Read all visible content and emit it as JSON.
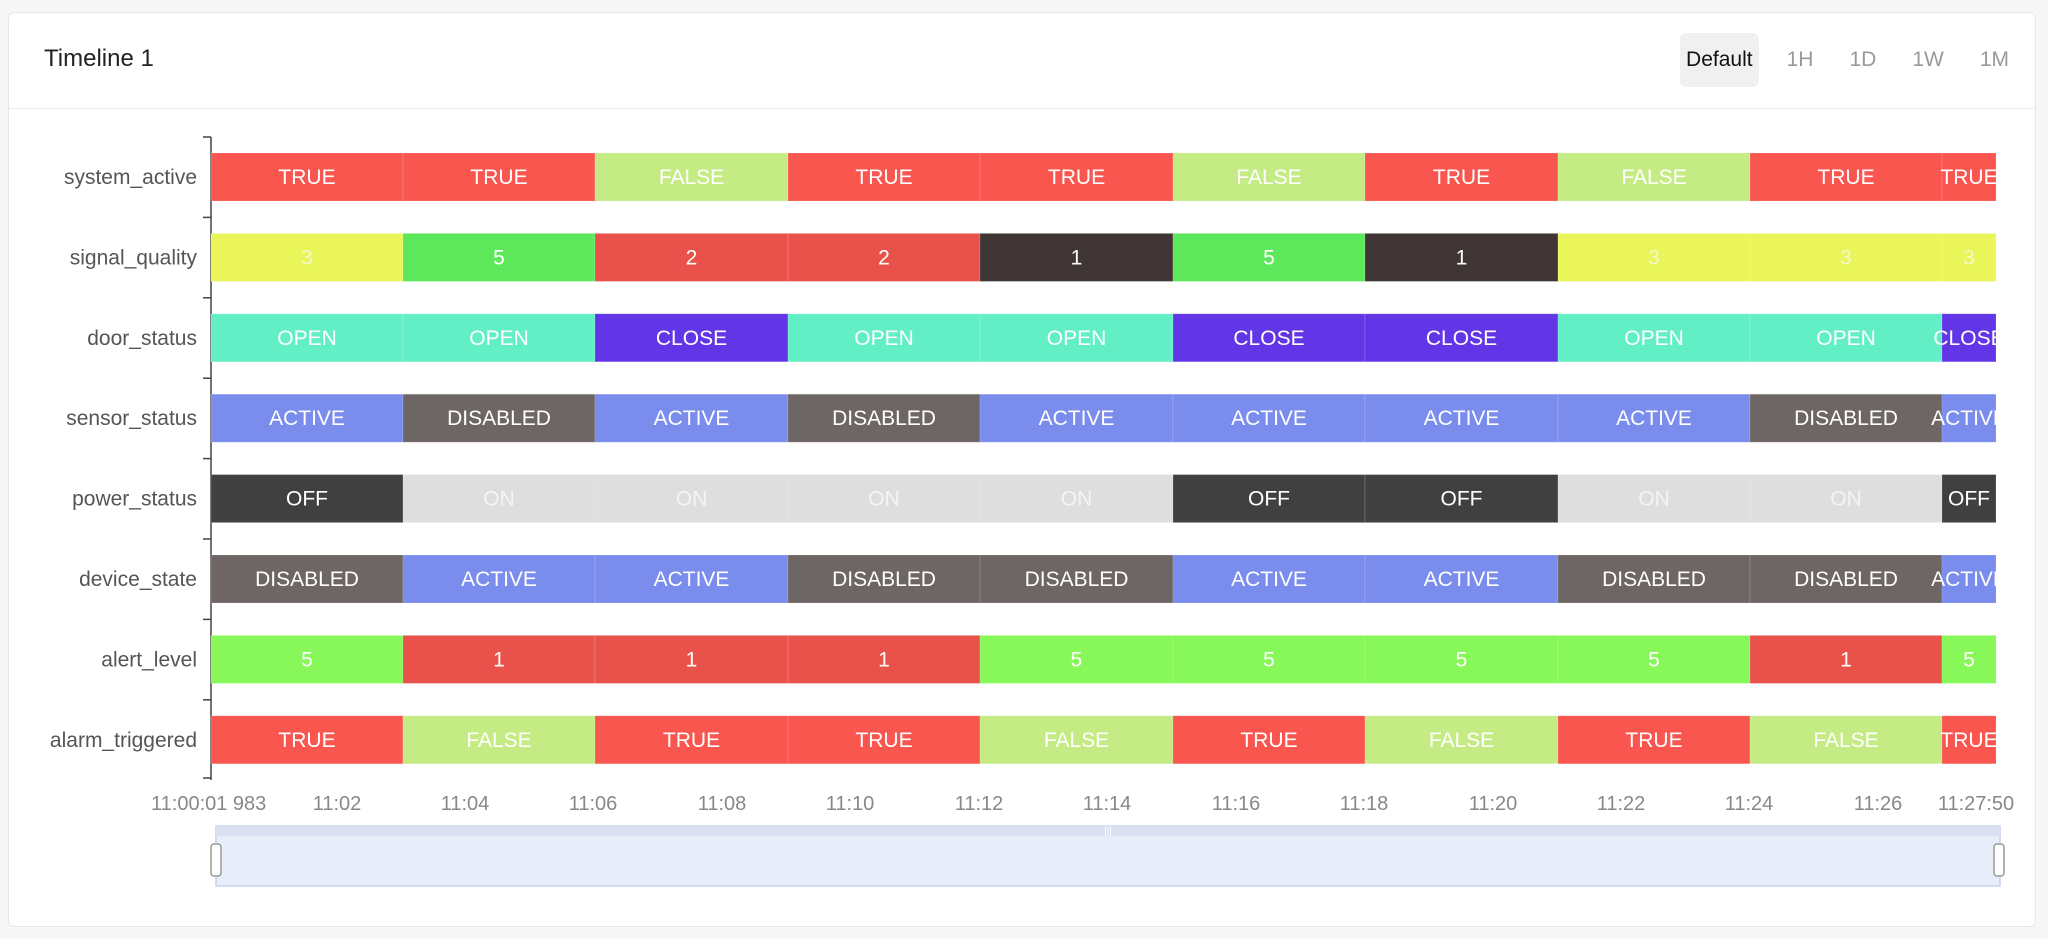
{
  "header": {
    "title": "Timeline 1",
    "range_options": [
      "Default",
      "1H",
      "1D",
      "1W",
      "1M"
    ],
    "active_range": "Default"
  },
  "chart_data": {
    "type": "timeline",
    "x_ticks": [
      "11:00:01 983",
      "11:02",
      "11:04",
      "11:06",
      "11:08",
      "11:10",
      "11:12",
      "11:14",
      "11:16",
      "11:18",
      "11:20",
      "11:22",
      "11:24",
      "11:26",
      "11:27:50"
    ],
    "rows": [
      {
        "name": "system_active",
        "values": [
          "TRUE",
          "TRUE",
          "FALSE",
          "TRUE",
          "TRUE",
          "FALSE",
          "TRUE",
          "FALSE",
          "TRUE",
          "TRUE"
        ]
      },
      {
        "name": "signal_quality",
        "values": [
          "3",
          "5",
          "2",
          "2",
          "1",
          "5",
          "1",
          "3",
          "3",
          "3"
        ]
      },
      {
        "name": "door_status",
        "values": [
          "OPEN",
          "OPEN",
          "CLOSE",
          "OPEN",
          "OPEN",
          "CLOSE",
          "CLOSE",
          "OPEN",
          "OPEN",
          "CLOSE"
        ]
      },
      {
        "name": "sensor_status",
        "values": [
          "ACTIVE",
          "DISABLED",
          "ACTIVE",
          "DISABLED",
          "ACTIVE",
          "ACTIVE",
          "ACTIVE",
          "ACTIVE",
          "DISABLED",
          "ACTIVE"
        ]
      },
      {
        "name": "power_status",
        "values": [
          "OFF",
          "ON",
          "ON",
          "ON",
          "ON",
          "OFF",
          "OFF",
          "ON",
          "ON",
          "OFF"
        ]
      },
      {
        "name": "device_state",
        "values": [
          "DISABLED",
          "ACTIVE",
          "ACTIVE",
          "DISABLED",
          "DISABLED",
          "ACTIVE",
          "ACTIVE",
          "DISABLED",
          "DISABLED",
          "ACTIVE"
        ]
      },
      {
        "name": "alert_level",
        "values": [
          "5",
          "1",
          "1",
          "1",
          "5",
          "5",
          "5",
          "5",
          "1",
          "5"
        ]
      },
      {
        "name": "alarm_triggered",
        "values": [
          "TRUE",
          "FALSE",
          "TRUE",
          "TRUE",
          "FALSE",
          "TRUE",
          "FALSE",
          "TRUE",
          "FALSE",
          "TRUE"
        ]
      }
    ],
    "colors": {
      "TRUE": "#fa5650",
      "FALSE": "#c5ec84",
      "OPEN": "#62efc6",
      "CLOSE": "#6236e6",
      "ACTIVE": "#7a8cec",
      "DISABLED": "#6e6664",
      "ON": "#dedede",
      "OFF": "#404040",
      "1": "#3f3535",
      "2": "#e9524a",
      "3": "#eaf55a",
      "5": "#5ce85a"
    },
    "alert_level_colors": {
      "1": "#e8524a",
      "5": "#88f75a"
    },
    "text_colors": {
      "ON": "#f4f4f4",
      "3": "#f6f8c8"
    }
  }
}
